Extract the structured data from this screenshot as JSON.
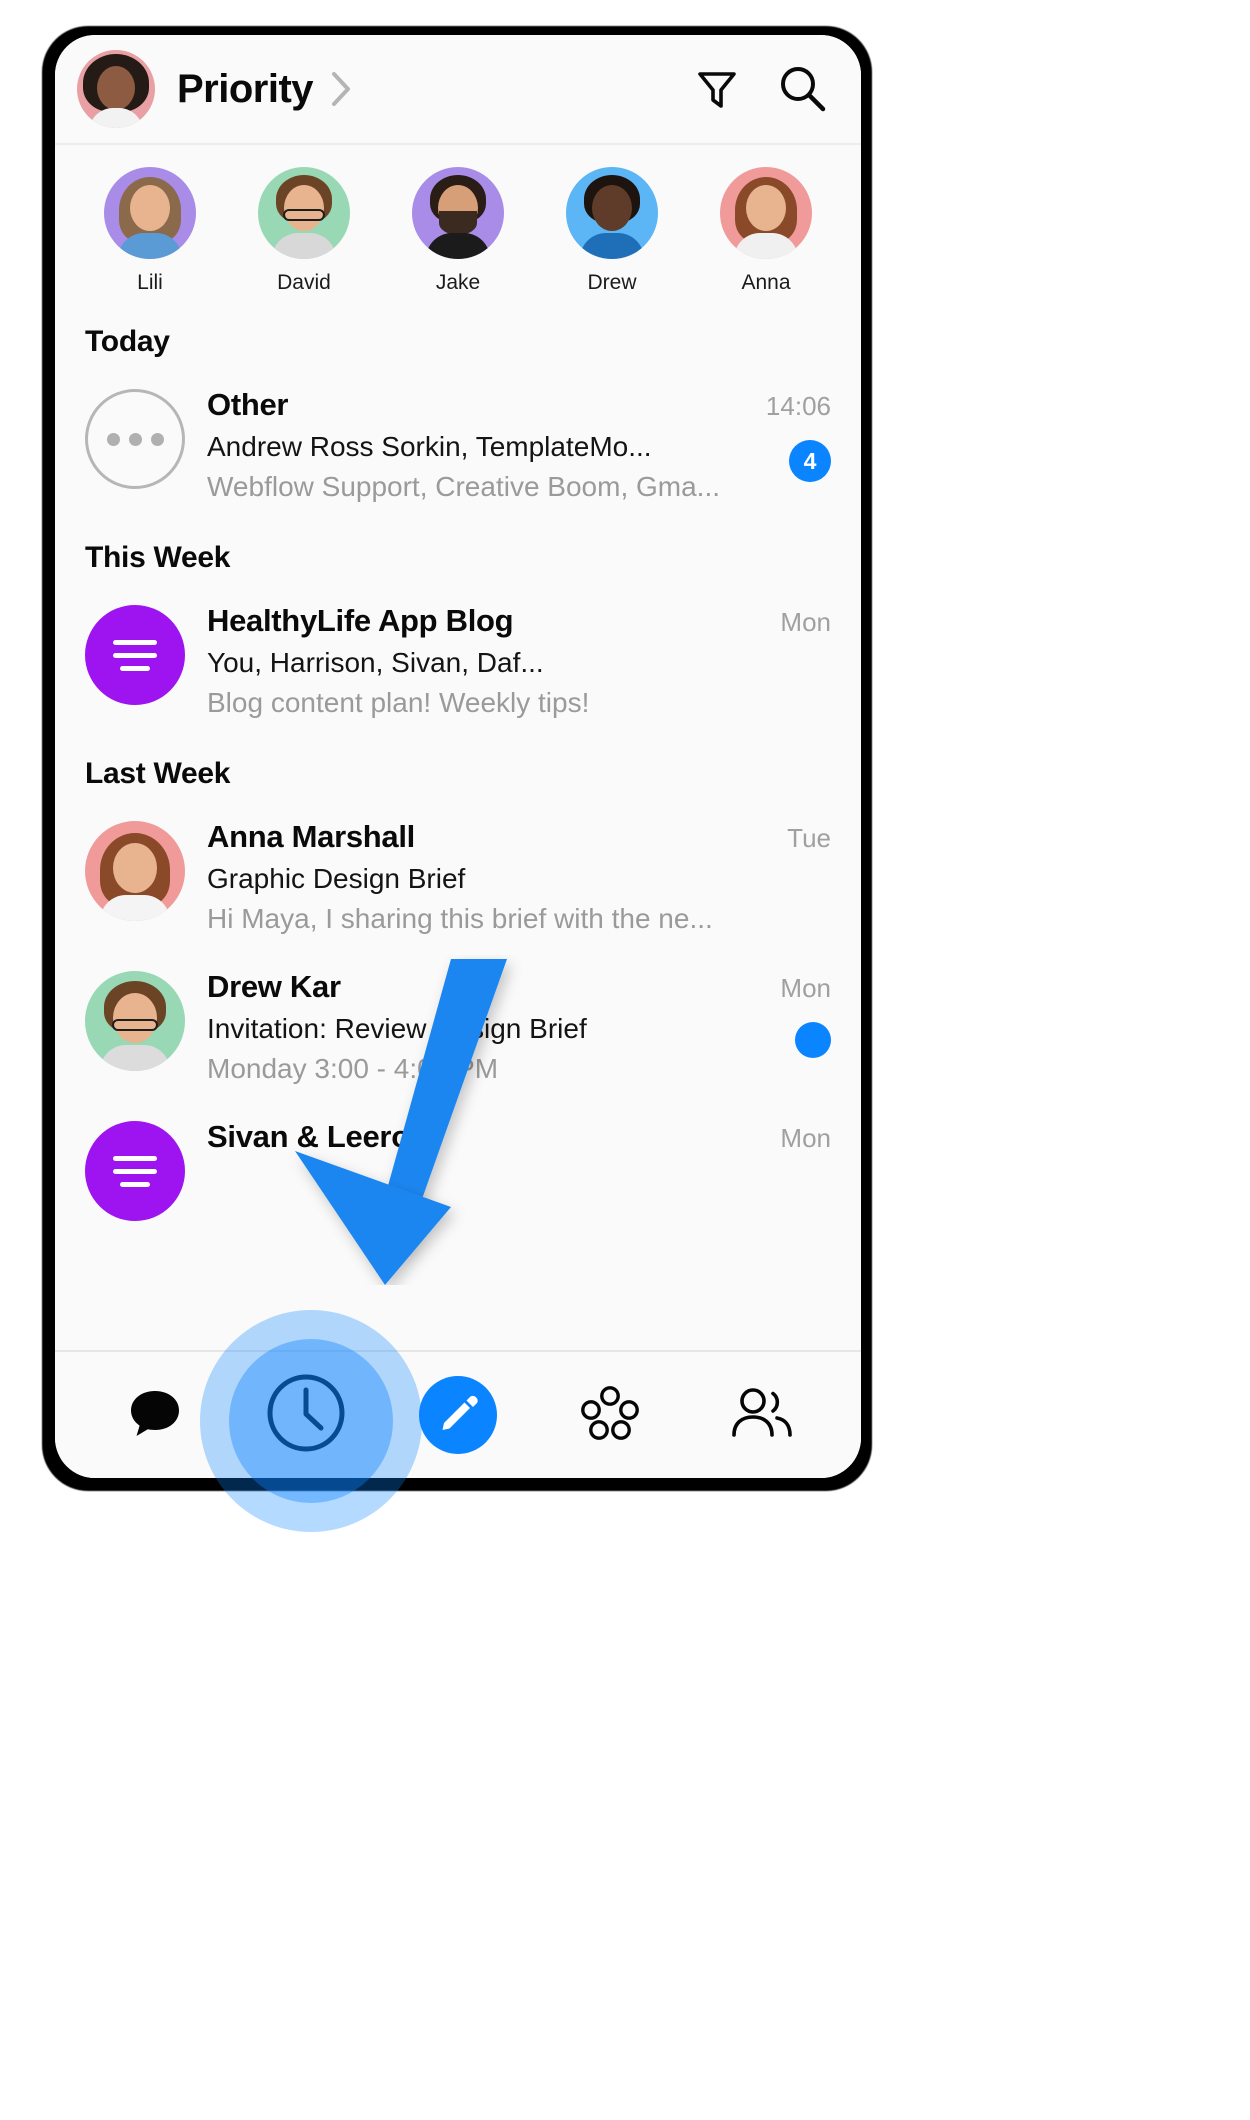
{
  "header": {
    "title": "Priority",
    "chevron_icon": "chevron-right-icon",
    "avatar_alt": "user-avatar",
    "filter_icon": "filter-icon",
    "search_icon": "search-icon"
  },
  "stories": [
    {
      "name": "Lili",
      "ring_color": "#a88ce8",
      "hair_color": "#8b6a4b",
      "face": "light",
      "torso_color": "#5b9bd5",
      "style": "long-hair"
    },
    {
      "name": "David",
      "ring_color": "#98d8b5",
      "hair_color": "#6b4426",
      "face": "light",
      "torso_color": "#d8d8d8",
      "style": "glasses"
    },
    {
      "name": "Jake",
      "ring_color": "#a88ce8",
      "hair_color": "#2a1d16",
      "face": "tan",
      "torso_color": "#1b1b1b",
      "style": "beard"
    },
    {
      "name": "Drew",
      "ring_color": "#5cb5f5",
      "hair_color": "#1d1410",
      "face": "dark",
      "torso_color": "#1f6fb8",
      "style": "short"
    },
    {
      "name": "Anna",
      "ring_color": "#f09a9a",
      "hair_color": "#8a4a2a",
      "face": "light",
      "torso_color": "#f0f0f0",
      "style": "long-hair"
    }
  ],
  "sections": [
    {
      "title": "Today",
      "conversations": [
        {
          "avatar_type": "dots",
          "avatar_icon": "ellipsis-icon",
          "title": "Other",
          "subtitle": "Andrew Ross Sorkin, TemplateMo...",
          "preview": "Webflow Support, Creative Boom, Gma...",
          "time": "14:06",
          "badge": "4",
          "badge_type": "count"
        }
      ]
    },
    {
      "title": "This Week",
      "conversations": [
        {
          "avatar_type": "lines",
          "avatar_icon": "list-lines-icon",
          "avatar_color": "#9d14f0",
          "title": "HealthyLife App Blog",
          "subtitle": "You, Harrison, Sivan, Daf...",
          "preview": "Blog content plan! Weekly tips!",
          "time": "Mon",
          "badge": "",
          "badge_type": "none"
        }
      ]
    },
    {
      "title": "Last Week",
      "conversations": [
        {
          "avatar_type": "photo",
          "avatar_icon": "contact-photo-anna",
          "ring_color": "#f09a9a",
          "hair_color": "#8a4a2a",
          "face": "light",
          "torso_color": "#f4f4f4",
          "style": "long-hair",
          "title": "Anna Marshall",
          "subtitle": "Graphic Design Brief",
          "preview": "Hi Maya, I sharing this brief with the ne...",
          "time": "Tue",
          "badge": "",
          "badge_type": "none"
        },
        {
          "avatar_type": "photo",
          "avatar_icon": "contact-photo-drew",
          "ring_color": "#98d8b5",
          "hair_color": "#6b4426",
          "face": "light",
          "torso_color": "#dcdcdc",
          "style": "glasses",
          "title": "Drew Kar",
          "subtitle": "Invitation: Review Design Brief",
          "preview": "Monday 3:00 - 4:00 PM",
          "time": "Mon",
          "badge": "",
          "badge_type": "dot"
        },
        {
          "avatar_type": "lines",
          "avatar_icon": "list-lines-icon",
          "avatar_color": "#9d14f0",
          "title": "Sivan & Leeron",
          "subtitle": "",
          "preview": "",
          "time": "Mon",
          "badge": "",
          "badge_type": "none"
        }
      ]
    }
  ],
  "tabbar": {
    "items": [
      {
        "name": "chats",
        "icon": "chat-bubble-icon",
        "active": true
      },
      {
        "name": "recent",
        "icon": "clock-icon",
        "active": false
      },
      {
        "name": "compose",
        "icon": "pencil-icon",
        "active": false
      },
      {
        "name": "bundles",
        "icon": "five-dots-icon",
        "active": false
      },
      {
        "name": "contacts",
        "icon": "people-icon",
        "active": false
      }
    ]
  },
  "overlay": {
    "arrow_icon": "down-arrow-annotation",
    "arrow_color": "#1a86f0",
    "tap_target": "recent-tab",
    "highlight_color": "#0a84ff"
  }
}
